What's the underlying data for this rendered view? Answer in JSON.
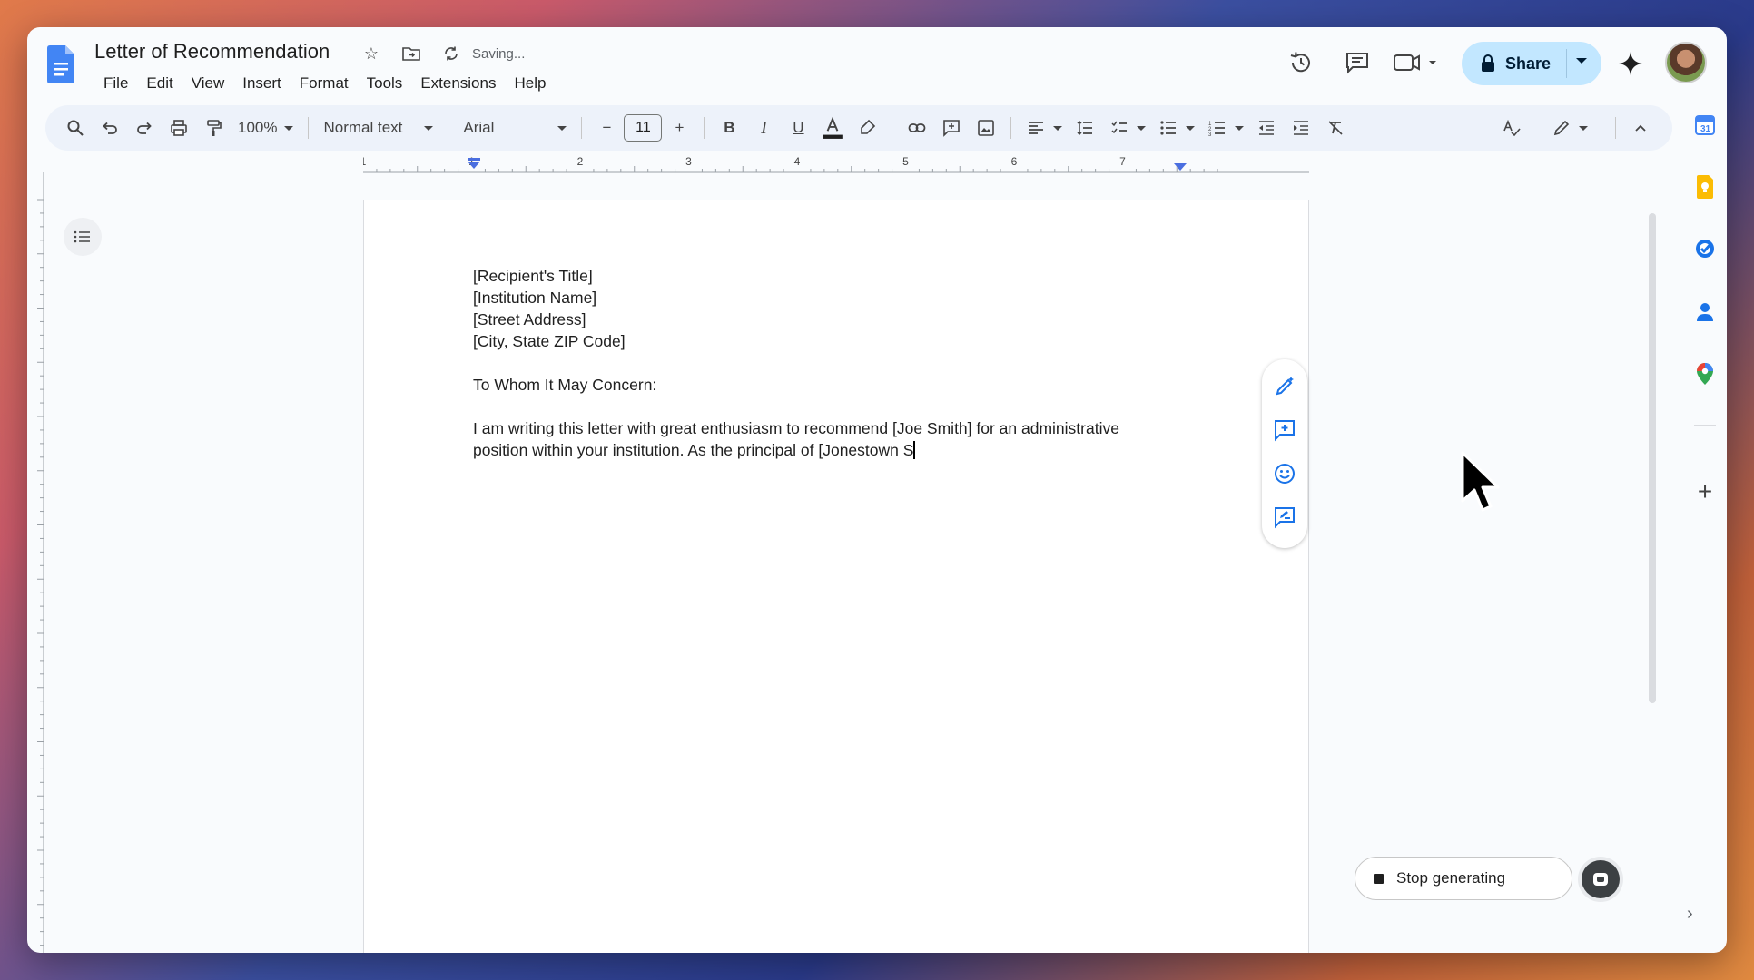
{
  "doc": {
    "title": "Letter of Recommendation",
    "status": "Saving..."
  },
  "menu": [
    "File",
    "Edit",
    "View",
    "Insert",
    "Format",
    "Tools",
    "Extensions",
    "Help"
  ],
  "header": {
    "share_label": "Share"
  },
  "toolbar": {
    "zoom": "100%",
    "style": "Normal text",
    "font": "Arial",
    "font_size": "11"
  },
  "ruler": {
    "labels": [
      "1",
      "1",
      "2",
      "3",
      "4",
      "5",
      "6",
      "7"
    ]
  },
  "content": {
    "lines": [
      "[Recipient's Title]",
      "[Institution Name]",
      "[Street Address]",
      "[City, State ZIP Code]"
    ],
    "salutation": "To Whom It May Concern:",
    "para_line1": "I am writing this letter with great enthusiasm to recommend [Joe Smith] for an administrative",
    "para_line2": "position within your institution. As the principal of [Jonestown S"
  },
  "assistant": {
    "stop_label": "Stop generating"
  },
  "colors": {
    "share_bg": "#c2e7ff",
    "toolbar_bg": "#edf2fa",
    "accent_blue": "#1a73e8"
  }
}
